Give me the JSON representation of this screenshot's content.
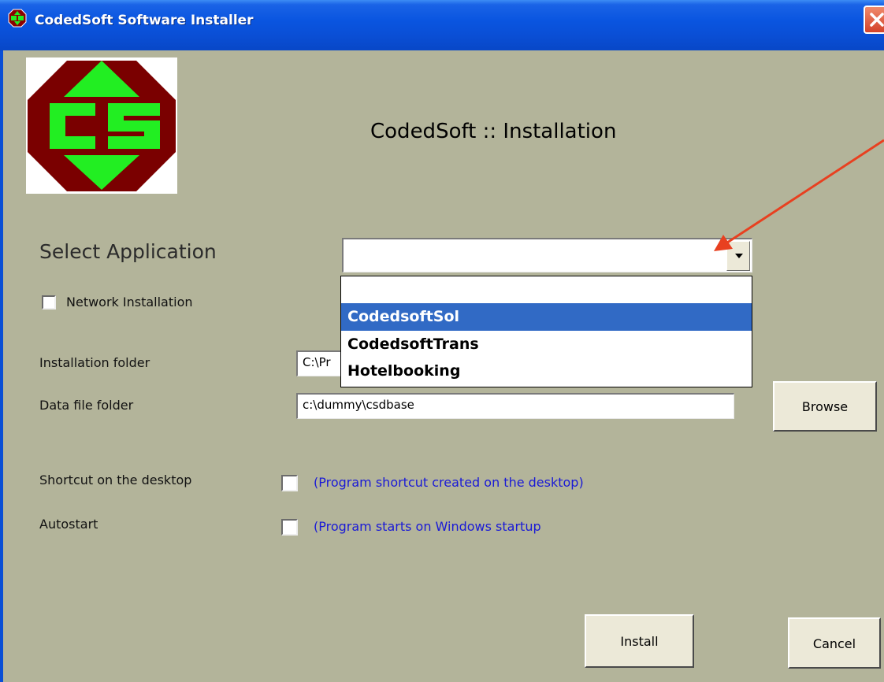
{
  "window": {
    "title": "CodedSoft Software Installer",
    "title_bar_color": "#0a4fd6"
  },
  "header": {
    "heading": "CodedSoft :: Installation"
  },
  "form": {
    "select_application_label": "Select Application",
    "select_application_value": "",
    "application_options": [
      "",
      "CodedsoftSol",
      "CodedsoftTrans",
      "Hotelbooking"
    ],
    "highlighted_option": "CodedsoftSol",
    "network_installation_label": "Network Installation",
    "network_installation_checked": false,
    "installation_folder_label": "Installation folder",
    "installation_folder_value": "C:\\Pr",
    "data_file_folder_label": "Data file folder",
    "data_file_folder_value": "c:\\dummy\\csdbase",
    "shortcut_label": "Shortcut on the desktop",
    "shortcut_note": "(Program shortcut created on the desktop)",
    "shortcut_checked": false,
    "autostart_label": "Autostart",
    "autostart_note": "(Program starts on Windows startup",
    "autostart_checked": false
  },
  "buttons": {
    "browse": "Browse",
    "install": "Install",
    "cancel": "Cancel"
  },
  "colors": {
    "dialog_background": "#b3b49a",
    "dropdown_highlight": "#316ac5",
    "annotation_arrow": "#e84020",
    "note_text": "#1a1ad6"
  },
  "icons": {
    "logo": "codedsoft-cs-logo",
    "close": "close-icon",
    "dropdown": "chevron-down-icon"
  }
}
